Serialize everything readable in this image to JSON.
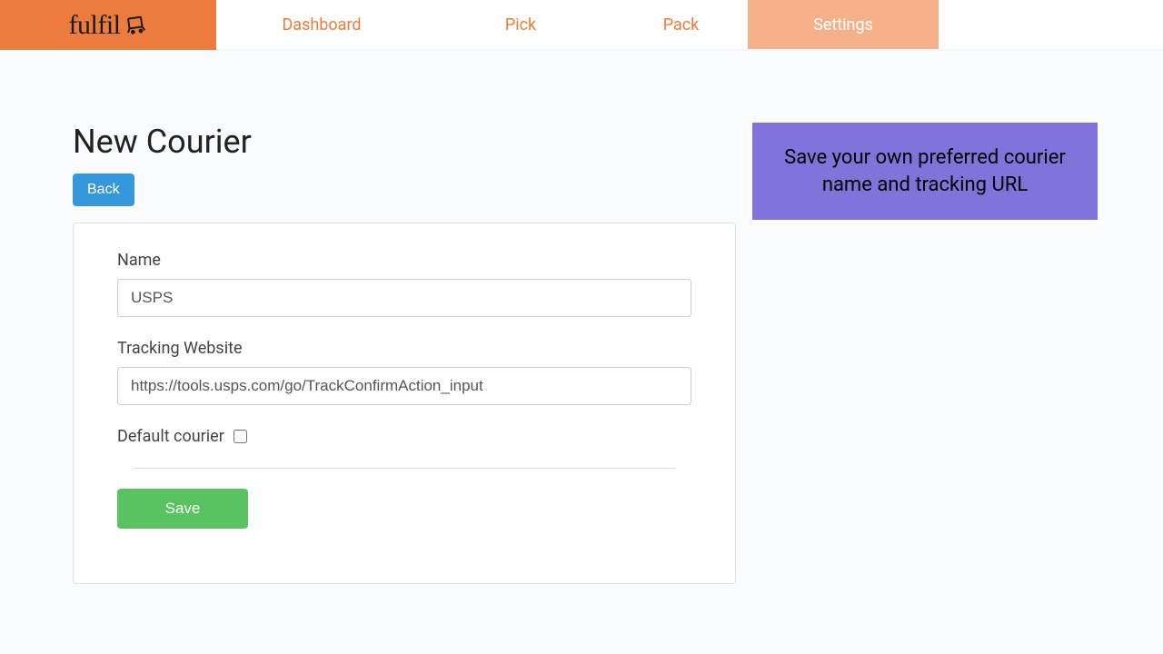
{
  "brand": {
    "name": "fulfil"
  },
  "nav": {
    "items": [
      {
        "label": "Dashboard"
      },
      {
        "label": "Pick"
      },
      {
        "label": "Pack"
      },
      {
        "label": "Settings"
      }
    ]
  },
  "page": {
    "title": "New Courier",
    "back_label": "Back"
  },
  "form": {
    "name_label": "Name",
    "name_value": "USPS",
    "tracking_label": "Tracking Website",
    "tracking_value": "https://tools.usps.com/go/TrackConfirmAction_input",
    "default_label": "Default courier",
    "default_checked": false,
    "save_label": "Save"
  },
  "help": {
    "text": "Save your own preferred courier name and tracking URL"
  }
}
